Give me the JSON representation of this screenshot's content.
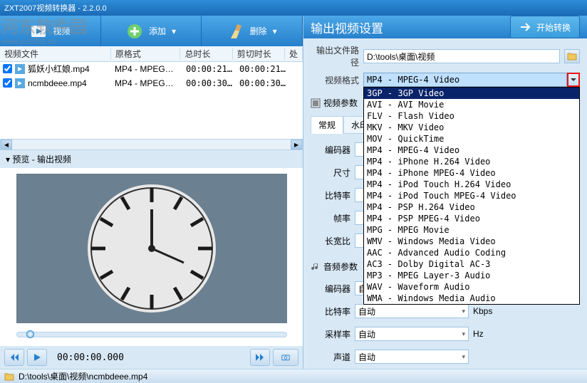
{
  "titlebar": {
    "text": "ZXT2007视频转换器 - 2.2.0.0"
  },
  "watermark": {
    "text": "河东软件园",
    "url": "www.pc0359.cn"
  },
  "toolbar": {
    "video_tab": "视频",
    "add_label": "添加",
    "delete_label": "删除"
  },
  "file_list": {
    "headers": {
      "name": "视频文件",
      "format": "原格式",
      "duration": "总时长",
      "cut": "剪切时长",
      "proc": "处"
    },
    "rows": [
      {
        "name": "狐妖小红娘.mp4",
        "format": "MP4 - MPEG…",
        "duration": "00:00:21…",
        "cut": "00:00:21…",
        "checked": true
      },
      {
        "name": "ncmbdeee.mp4",
        "format": "MP4 - MPEG…",
        "duration": "00:00:30…",
        "cut": "00:00:30…",
        "checked": true
      }
    ]
  },
  "preview": {
    "title": "预览 - 输出视频",
    "time": "00:00:00.000"
  },
  "output": {
    "header": "输出视频设置",
    "start_label": "开始转换",
    "path_label": "输出文件路径",
    "path_value": "D:\\tools\\桌面\\视频",
    "format_label": "视频格式",
    "format_value": "MP4 - MPEG-4 Video",
    "format_options": [
      "3GP - 3GP Video",
      "AVI - AVI Movie",
      "FLV - Flash Video",
      "MKV - MKV Video",
      "MOV - QuickTime",
      "MP4 - MPEG-4 Video",
      "MP4 - iPhone H.264 Video",
      "MP4 - iPhone MPEG-4 Video",
      "MP4 - iPod Touch H.264 Video",
      "MP4 - iPod Touch MPEG-4 Video",
      "MP4 - PSP H.264 Video",
      "MP4 - PSP MPEG-4 Video",
      "MPG - MPEG Movie",
      "WMV - Windows Media Video",
      "AAC - Advanced Audio Coding",
      "AC3 - Dolby Digital AC-3",
      "MP3 - MPEG Layer-3 Audio",
      "WAV - Waveform Audio",
      "WMA - Windows Media Audio"
    ],
    "video_params_head": "视频参数",
    "tabs": {
      "general": "常规",
      "watermark": "水印"
    },
    "params": {
      "encoder": {
        "label": "编码器",
        "value": ""
      },
      "size": {
        "label": "尺寸",
        "value": ""
      },
      "bitrate": {
        "label": "比特率",
        "value": ""
      },
      "fps": {
        "label": "帧率",
        "value": ""
      },
      "aspect": {
        "label": "长宽比",
        "value": ""
      }
    },
    "audio_params_head": "音频参数",
    "audio": {
      "encoder": {
        "label": "编码器",
        "value": "自动"
      },
      "bitrate": {
        "label": "比特率",
        "value": "自动",
        "unit": "Kbps"
      },
      "sample": {
        "label": "采样率",
        "value": "自动",
        "unit": "Hz"
      },
      "channel": {
        "label": "声道",
        "value": "自动"
      }
    }
  },
  "statusbar": {
    "path": "D:\\tools\\桌面\\视频\\ncmbdeee.mp4"
  }
}
